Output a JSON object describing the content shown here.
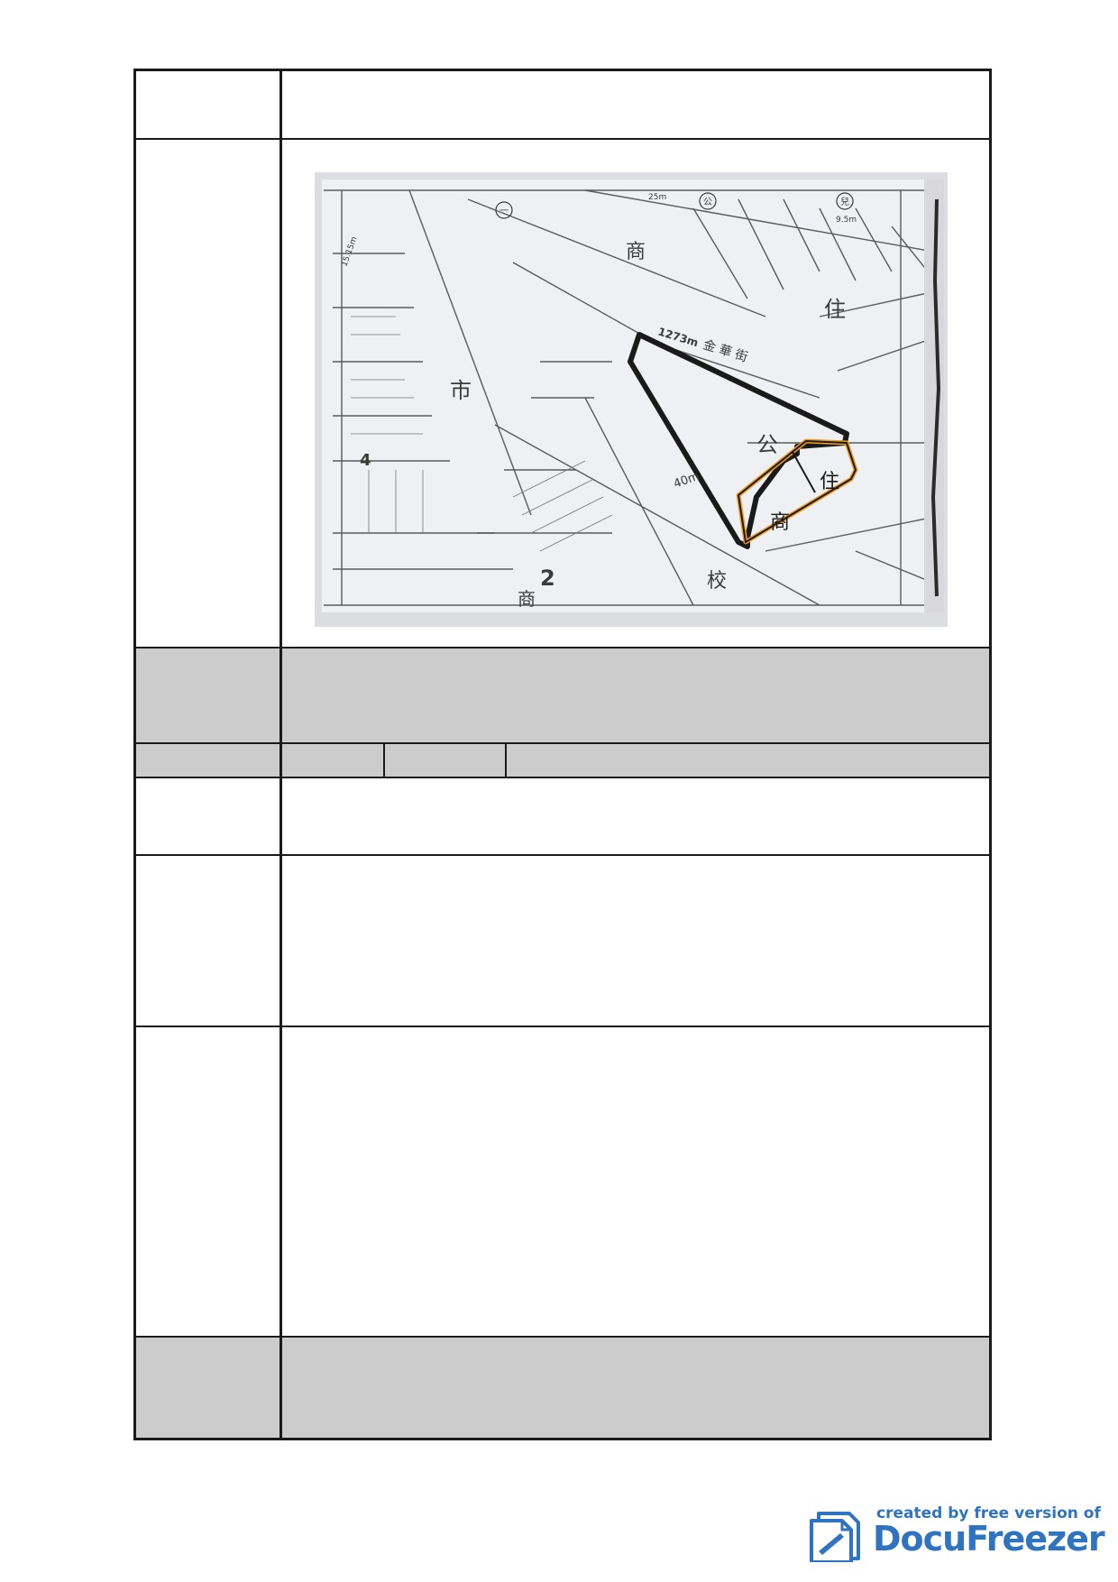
{
  "document": {
    "rows": [
      {
        "label": "",
        "value": ""
      },
      {
        "label": "",
        "value": ""
      },
      {
        "label": "",
        "value": ""
      },
      {
        "label": "",
        "cells": [
          "",
          "",
          ""
        ]
      },
      {
        "label": "",
        "value": ""
      },
      {
        "label": "",
        "value": ""
      },
      {
        "label": "",
        "value": ""
      },
      {
        "label": "",
        "value": ""
      }
    ]
  },
  "map": {
    "labels": {
      "road_width_top": "25m",
      "road_width_top_right": "9.5m",
      "road_width_left": "15.15m",
      "road_length": "1273m",
      "road_name": "金 華 街",
      "road_width_diag": "40m",
      "zone_market": "市",
      "zone_park": "公",
      "zone_residential": "住",
      "zone_residential_2": "住",
      "zone_commercial": "商",
      "zone_commercial_2": "商",
      "zone_commercial_3": "商",
      "zone_school": "校",
      "block_2": "2",
      "block_4": "4",
      "circle_1": "一",
      "circle_2": "公",
      "circle_3": "兒"
    },
    "colors": {
      "parcel_outline": "#1a1a1a",
      "highlight_outline": "#f0a020"
    }
  },
  "watermark": {
    "line1": "created by free version of",
    "line2": "DocuFreezer"
  }
}
